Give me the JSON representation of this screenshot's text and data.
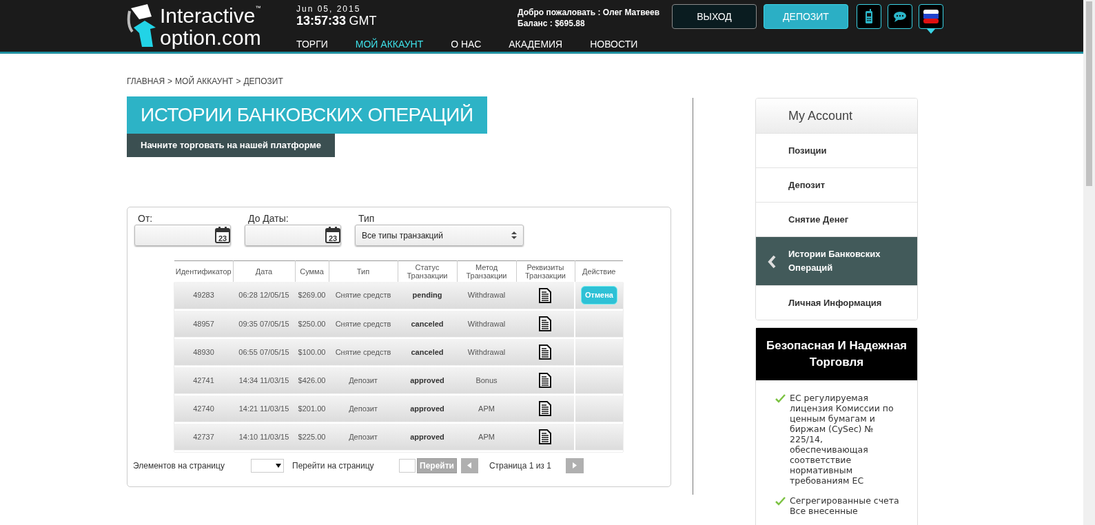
{
  "header": {
    "logo": {
      "line1": "Interactive",
      "tm": "™",
      "line2": "option.com"
    },
    "date": "Jun 05, 2015",
    "time": "13:57:33",
    "timezone": "GMT",
    "welcome": {
      "label": "Добро пожаловать : ",
      "name": "Олег Матвеев",
      "balance_label": "Баланс : ",
      "balance": "$695.88"
    },
    "buttons": [
      {
        "label": "ВЫХОД",
        "kind": "dark"
      },
      {
        "label": "ДЕПОЗИТ",
        "kind": "accent"
      }
    ],
    "nav": [
      {
        "label": "ТОРГИ",
        "selected": false
      },
      {
        "label": "МОЙ АККАУНТ",
        "selected": true
      },
      {
        "label": "О НАС",
        "selected": false
      },
      {
        "label": "АКАДЕМИЯ",
        "selected": false
      },
      {
        "label": "НОВОСТИ",
        "selected": false
      }
    ]
  },
  "breadcrumb": [
    "ГЛАВНАЯ",
    ">",
    "МОЙ АККАУНТ",
    ">",
    "ДЕПОЗИТ"
  ],
  "page_title": "ИСТОРИИ БАНКОВСКИХ ОПЕРАЦИЙ",
  "subtitle": "Начните торговать на нашей платформе",
  "filters": {
    "from_label": "От:",
    "to_label": "До Даты:",
    "type_label": "Тип",
    "type_value": "Все типы транзакций",
    "from_calendar_day": "23",
    "to_calendar_day": "23"
  },
  "table": {
    "columns": [
      "Идентификатор",
      "Дата",
      "Сумма",
      "Тип",
      "Статус Транзакции",
      "Метод Транзакции",
      "Реквизиты Транзакции",
      "Действие"
    ],
    "rows": [
      {
        "id": "49283",
        "date": "06:28 12/05/15",
        "amount": "$269.00",
        "type": "Снятие средств",
        "status": "pending",
        "method": "Withdrawal",
        "action": "Отмена"
      },
      {
        "id": "48957",
        "date": "09:35 07/05/15",
        "amount": "$250.00",
        "type": "Снятие средств",
        "status": "canceled",
        "method": "Withdrawal"
      },
      {
        "id": "48930",
        "date": "06:55 07/05/15",
        "amount": "$100.00",
        "type": "Снятие средств",
        "status": "canceled",
        "method": "Withdrawal"
      },
      {
        "id": "42741",
        "date": "14:34 11/03/15",
        "amount": "$426.00",
        "type": "Депозит",
        "status": "approved",
        "method": "Bonus"
      },
      {
        "id": "42740",
        "date": "14:21 11/03/15",
        "amount": "$201.00",
        "type": "Депозит",
        "status": "approved",
        "method": "APM"
      },
      {
        "id": "42737",
        "date": "14:10 11/03/15",
        "amount": "$225.00",
        "type": "Депозит",
        "status": "approved",
        "method": "APM"
      }
    ]
  },
  "pagination": {
    "per_page_label": "Элементов на страницу",
    "goto_label": "Перейти на страницу",
    "goto_button": "Перейти",
    "page_text": "Страница 1 из 1"
  },
  "sidebar": {
    "title": "My Account",
    "items": [
      {
        "label": "Позиции",
        "selected": false
      },
      {
        "label": "Депозит",
        "selected": false
      },
      {
        "label": "Снятие Денег",
        "selected": false
      },
      {
        "label": "Истории Банковских Операций",
        "selected": true
      },
      {
        "label": "Личная Информация",
        "selected": false
      }
    ]
  },
  "safety": {
    "title": "Безопасная И Надежная Торговля",
    "points": [
      "ЕС регулируемая лицензия Комиссии по ценным бумагам и биржам (CySec) № 225/14, обеспечивающая соответствие нормативным требованиям ЕС",
      "Сегрегированные счета Все внесенные"
    ]
  }
}
